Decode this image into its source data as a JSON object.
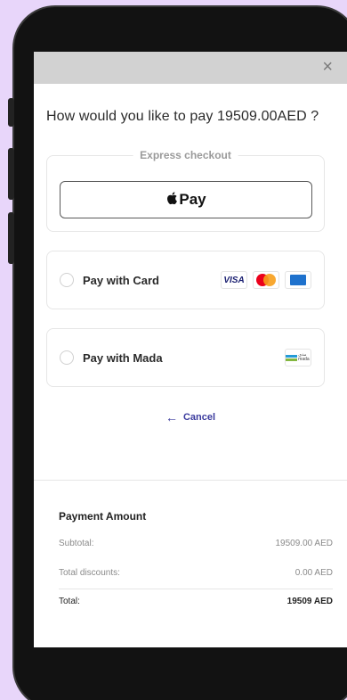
{
  "dialog": {
    "close_symbol": "×",
    "title": "How would you like to pay 19509.00AED ?"
  },
  "express": {
    "label": "Express checkout",
    "apple_pay_label": "Pay"
  },
  "options": [
    {
      "label": "Pay with Card",
      "logos": [
        "VISA",
        "mastercard",
        "amex"
      ]
    },
    {
      "label": "Pay with Mada",
      "logos": [
        "mada"
      ]
    }
  ],
  "card_logos": {
    "visa": "VISA"
  },
  "mada_logo": {
    "text": "مدى mada"
  },
  "cancel": {
    "arrow": "←",
    "label": "Cancel"
  },
  "summary": {
    "title": "Payment Amount",
    "rows": [
      {
        "label": "Subtotal:",
        "value": "19509.00 AED"
      },
      {
        "label": "Total discounts:",
        "value": "0.00 AED"
      },
      {
        "label": "Total:",
        "value": "19509 AED"
      }
    ]
  },
  "colors": {
    "accent": "#3b3b9e",
    "background": "#e8d6fa"
  }
}
